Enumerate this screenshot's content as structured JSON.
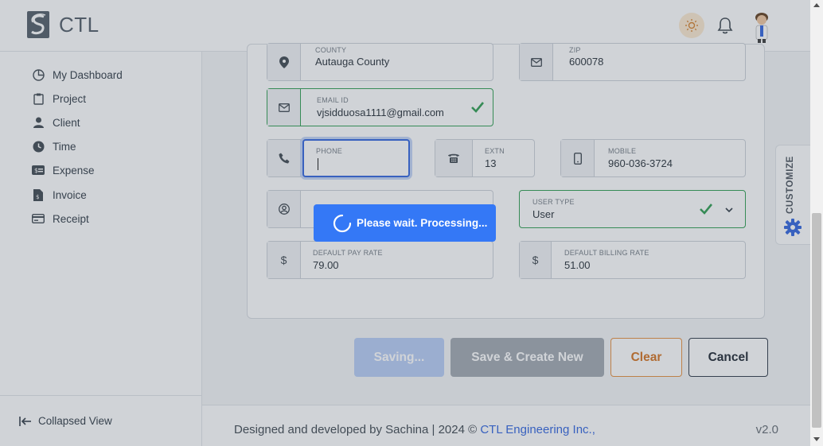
{
  "header": {
    "brand": "CTL",
    "theme_icon": "sun-icon",
    "notification_icon": "bell-icon",
    "avatar_icon": "user-avatar-icon",
    "accent_color": "#3478f6"
  },
  "sidebar": {
    "items": [
      {
        "label": "My Dashboard",
        "icon": "dashboard-icon"
      },
      {
        "label": "Project",
        "icon": "clipboard-icon"
      },
      {
        "label": "Client",
        "icon": "person-icon"
      },
      {
        "label": "Time",
        "icon": "clock-icon"
      },
      {
        "label": "Expense",
        "icon": "money-icon"
      },
      {
        "label": "Invoice",
        "icon": "invoice-icon"
      },
      {
        "label": "Receipt",
        "icon": "receipt-icon"
      }
    ],
    "collapse_label": "Collapsed View"
  },
  "form": {
    "county": {
      "label": "COUNTY",
      "value": "Autauga County"
    },
    "zip": {
      "label": "ZIP",
      "value": "600078"
    },
    "email": {
      "label": "EMAIL ID",
      "value": "vjsidduosa1111@gmail.com"
    },
    "phone": {
      "label": "PHONE",
      "value": ""
    },
    "extn": {
      "label": "EXTN",
      "value": "13"
    },
    "mobile": {
      "label": "MOBILE",
      "value": "960-036-3724"
    },
    "user_type": {
      "label": "USER TYPE",
      "value": "User"
    },
    "pay_rate": {
      "label": "DEFAULT PAY RATE",
      "prefix": "$",
      "value": "79.00"
    },
    "billing_rate": {
      "label": "DEFAULT BILLING RATE",
      "prefix": "$",
      "value": "51.00"
    }
  },
  "buttons": {
    "saving": "Saving...",
    "save_new": "Save & Create New",
    "clear": "Clear",
    "cancel": "Cancel"
  },
  "processing": {
    "text": "Please wait. Processing..."
  },
  "customize": {
    "label": "CUSTOMIZE"
  },
  "footer": {
    "text": "Designed and developed by Sachina | 2024 © ",
    "link": "CTL Engineering Inc.,",
    "version": "v2.0"
  }
}
